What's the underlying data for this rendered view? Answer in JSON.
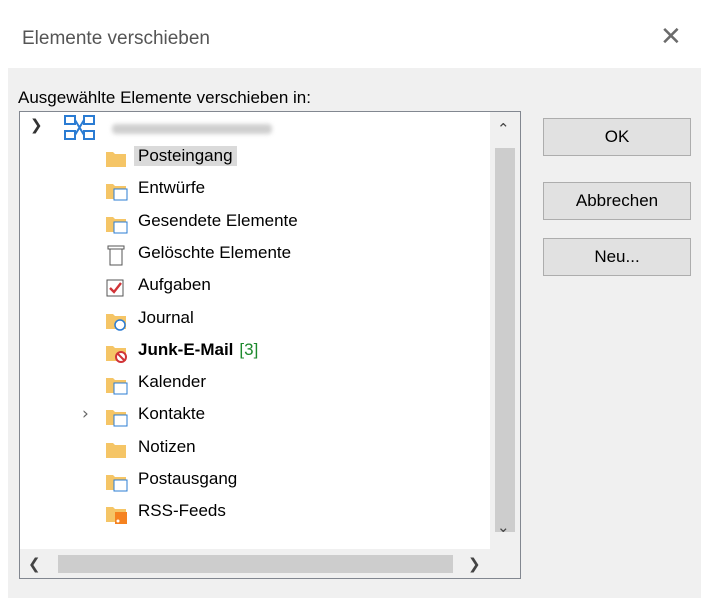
{
  "dialog": {
    "title": "Elemente verschieben",
    "prompt": "Ausgewählte Elemente verschieben in:"
  },
  "account": {
    "icon": "exchange-account-icon",
    "email_blurred": true
  },
  "folders": [
    {
      "label": "Posteingang",
      "icon": "inbox-folder-icon",
      "selected": true
    },
    {
      "label": "Entwürfe",
      "icon": "drafts-folder-icon"
    },
    {
      "label": "Gesendete Elemente",
      "icon": "sent-items-folder-icon"
    },
    {
      "label": "Gelöschte Elemente",
      "icon": "deleted-items-trash-icon"
    },
    {
      "label": "Aufgaben",
      "icon": "tasks-checkbox-icon"
    },
    {
      "label": "Journal",
      "icon": "journal-clock-icon"
    },
    {
      "label": "Junk-E-Mail",
      "icon": "junk-mail-folder-icon",
      "count": "[3]",
      "bold": true
    },
    {
      "label": "Kalender",
      "icon": "calendar-folder-icon"
    },
    {
      "label": "Kontakte",
      "icon": "contacts-folder-icon",
      "expandable": true
    },
    {
      "label": "Notizen",
      "icon": "notes-folder-icon"
    },
    {
      "label": "Postausgang",
      "icon": "outbox-folder-icon"
    },
    {
      "label": "RSS-Feeds",
      "icon": "rss-feeds-folder-icon"
    }
  ],
  "buttons": {
    "ok": "OK",
    "cancel": "Abbrechen",
    "new": "Neu..."
  },
  "colors": {
    "folder": "#f5c566",
    "accent_blue": "#2b7cd3",
    "count_green": "#1e8a2e",
    "selected_bg": "#dadada"
  }
}
